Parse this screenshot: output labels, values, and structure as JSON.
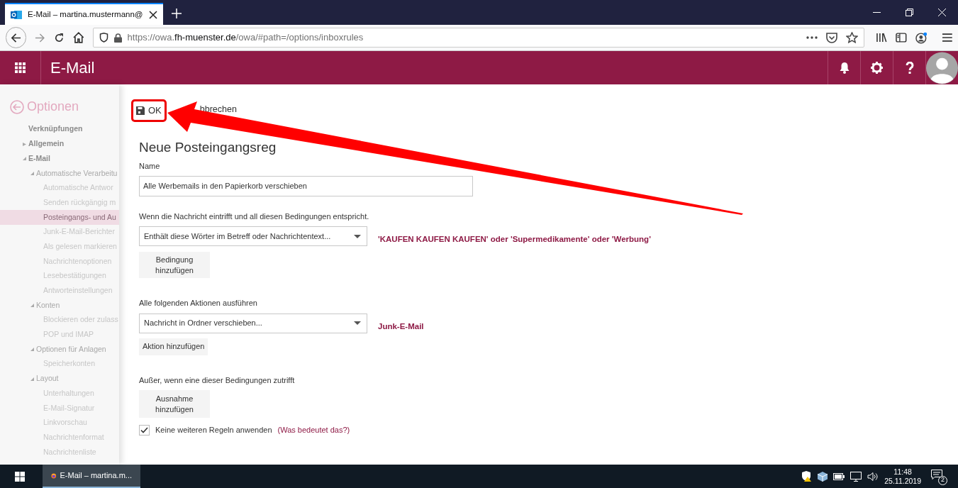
{
  "browser": {
    "tab_title": "E-Mail – martina.mustermann@",
    "url_scheme": "https://owa.",
    "url_domain": "fh-muenster.de",
    "url_path": "/owa/#path=/options/inboxrules"
  },
  "app_header": {
    "title": "E-Mail"
  },
  "sidebar": {
    "title": "Optionen",
    "items": [
      {
        "label": "Verknüpfungen",
        "selected": false
      },
      {
        "label": "Allgemein",
        "selected": false,
        "expanded": false
      },
      {
        "label": "E-Mail",
        "selected": false,
        "expanded": true,
        "children": [
          {
            "label": "Automatische Verarbeitu",
            "selected": false,
            "expanded": true,
            "children": [
              {
                "label": "Automatische Antwor",
                "selected": false
              },
              {
                "label": "Senden rückgängig m",
                "selected": false
              },
              {
                "label": "Posteingangs- und Au",
                "selected": true
              },
              {
                "label": "Junk-E-Mail-Berichter",
                "selected": false
              },
              {
                "label": "Als gelesen markieren",
                "selected": false
              },
              {
                "label": "Nachrichtenoptionen",
                "selected": false
              },
              {
                "label": "Lesebestätigungen",
                "selected": false
              },
              {
                "label": "Antworteinstellungen",
                "selected": false
              }
            ]
          },
          {
            "label": "Konten",
            "selected": false,
            "expanded": true,
            "children": [
              {
                "label": "Blockieren oder zulass",
                "selected": false
              },
              {
                "label": "POP und IMAP",
                "selected": false
              }
            ]
          },
          {
            "label": "Optionen für Anlagen",
            "selected": false,
            "expanded": true,
            "children": [
              {
                "label": "Speicherkonten",
                "selected": false
              }
            ]
          },
          {
            "label": "Layout",
            "selected": false,
            "expanded": true,
            "children": [
              {
                "label": "Unterhaltungen",
                "selected": false
              },
              {
                "label": "E-Mail-Signatur",
                "selected": false
              },
              {
                "label": "Linkvorschau",
                "selected": false
              },
              {
                "label": "Nachrichtenformat",
                "selected": false
              },
              {
                "label": "Nachrichtenliste",
                "selected": false
              }
            ]
          }
        ]
      }
    ]
  },
  "toolbar": {
    "ok": "OK",
    "cancel": "bbrechen"
  },
  "form": {
    "heading": "Neue Posteingangsreg",
    "name_label": "Name",
    "name_value": "Alle Werbemails in den Papierkorb verschieben",
    "condition_label": "Wenn die Nachricht eintrifft und all diesen Bedingungen entspricht.",
    "condition_select": "Enthält diese Wörter im Betreff oder Nachrichtentext...",
    "condition_value": "'KAUFEN KAUFEN KAUFEN' oder 'Supermedikamente' oder 'Werbung'",
    "add_condition": "Bedingung hinzufügen",
    "action_label": "Alle folgenden Aktionen ausführen",
    "action_select": "Nachricht in Ordner verschieben...",
    "action_value": "Junk-E-Mail",
    "add_action": "Aktion hinzufügen",
    "exception_label": "Außer, wenn eine dieser Bedingungen zutrifft",
    "add_exception": "Ausnahme hinzufügen",
    "stop_rules": {
      "label": "Keine weiteren Regeln anwenden",
      "checked": true
    },
    "help_link": "(Was bedeutet das?)"
  },
  "taskbar": {
    "app": "E-Mail – martina.m...",
    "time": "11:48",
    "date": "25.11.2019",
    "notifications": "2"
  }
}
